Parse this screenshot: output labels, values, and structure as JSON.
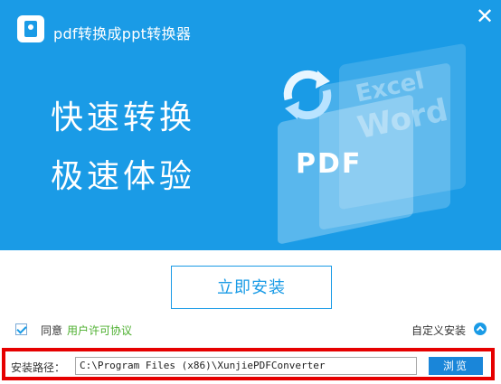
{
  "app": {
    "title": "pdf转换成ppt转换器",
    "logo_icon": "pdf-logo-icon"
  },
  "header": {
    "close_label": "✕",
    "slogan_line1": "快速转换",
    "slogan_line2": "极速体验",
    "illustration": {
      "excel_text": "Excel",
      "word_text": "Word",
      "pdf_text": "PDF"
    }
  },
  "install": {
    "button_label": "立即安装"
  },
  "agreement": {
    "checked": true,
    "agree_label": "同意",
    "license_link": "用户许可协议"
  },
  "custom": {
    "label": "自定义安装"
  },
  "path": {
    "label": "安装路径：",
    "value": "C:\\Program Files (x86)\\XunjiePDFConverter",
    "browse_label": "浏览"
  },
  "colors": {
    "brand_blue": "#1a9be6",
    "link_green": "#4caf2e",
    "highlight_red": "#e60000"
  }
}
